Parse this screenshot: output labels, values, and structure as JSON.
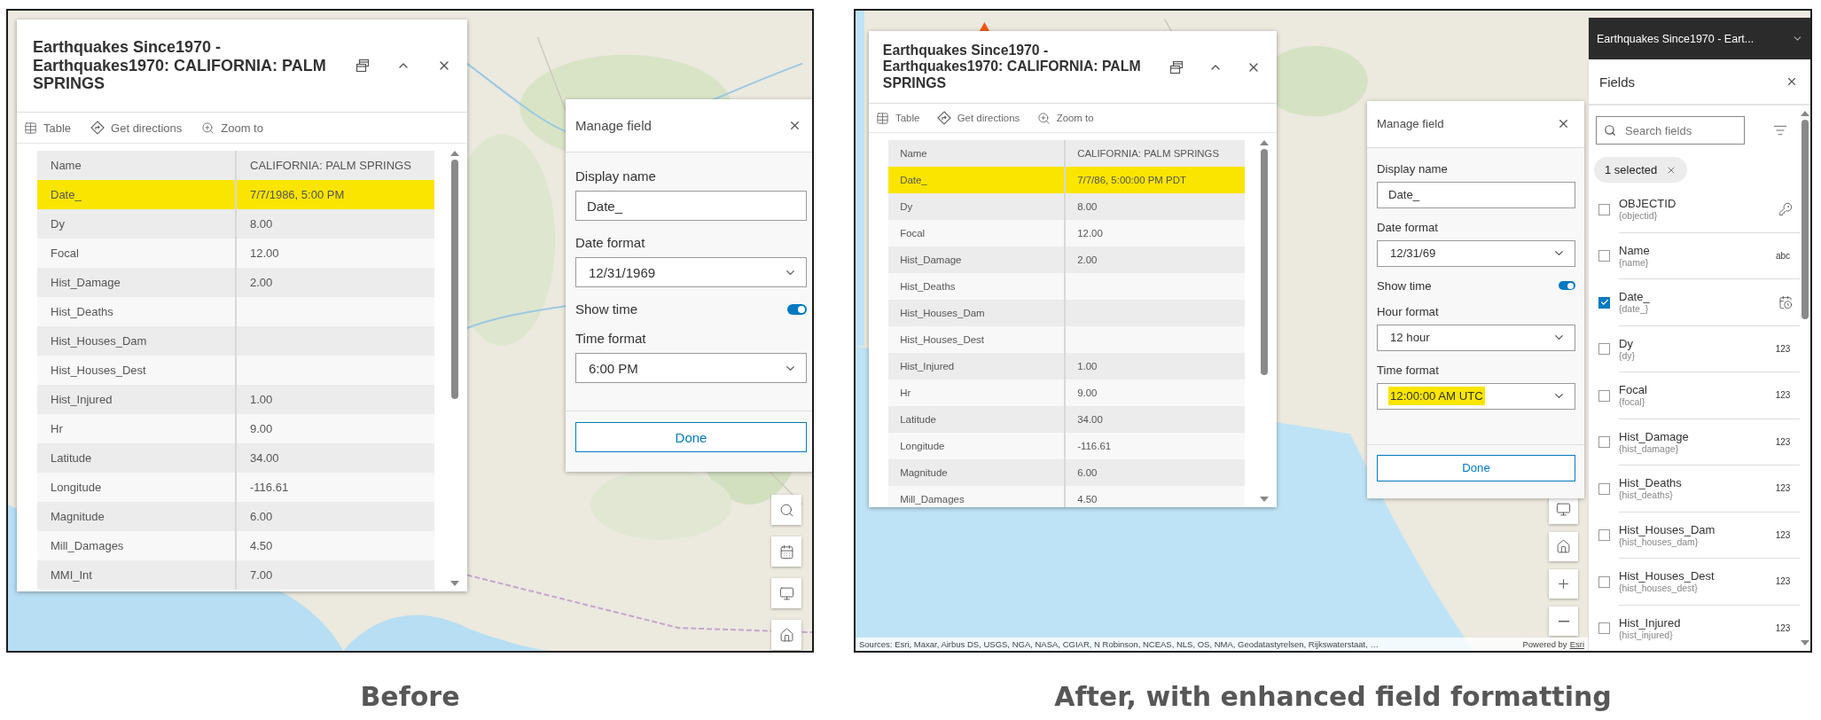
{
  "panels": [
    {
      "caption": "Before",
      "map": {
        "kind": "picture"
      },
      "popup": {
        "title": "Earthquakes Since1970 - Earthquakes1970: CALIFORNIA: PALM SPRINGS",
        "actions": [
          {
            "kind": "table",
            "label": "Table"
          },
          {
            "kind": "directions",
            "label": "Get directions"
          },
          {
            "kind": "zoom",
            "label": "Zoom to"
          }
        ],
        "rows": [
          {
            "name": "Name",
            "value": "CALIFORNIA: PALM SPRINGS",
            "highlighted": false
          },
          {
            "name": "Date_",
            "value": "7/7/1986, 5:00 PM",
            "highlighted": true
          },
          {
            "name": "Dy",
            "value": "8.00",
            "highlighted": false
          },
          {
            "name": "Focal",
            "value": "12.00",
            "highlighted": false
          },
          {
            "name": "Hist_Damage",
            "value": "2.00",
            "highlighted": false
          },
          {
            "name": "Hist_Deaths",
            "highlighted": false
          },
          {
            "name": "Hist_Houses_Dam",
            "highlighted": false
          },
          {
            "name": "Hist_Houses_Dest",
            "highlighted": false
          },
          {
            "name": "Hist_Injured",
            "value": "1.00",
            "highlighted": false
          },
          {
            "name": "Hr",
            "value": "9.00",
            "highlighted": false
          },
          {
            "name": "Latitude",
            "value": "34.00",
            "highlighted": false
          },
          {
            "name": "Longitude",
            "value": "-116.61",
            "highlighted": false
          },
          {
            "name": "Magnitude",
            "value": "6.00",
            "highlighted": false
          },
          {
            "name": "Mill_Damages",
            "value": "4.50",
            "highlighted": false
          },
          {
            "name": "MMI_Int",
            "value": "7.00",
            "highlighted": false
          }
        ]
      },
      "manage_field": {
        "title": "Manage field",
        "done": "Done",
        "settings": [
          {
            "kind": "text",
            "label": "Display name",
            "value": "Date_"
          },
          {
            "kind": "select",
            "label": "Date format",
            "value": "12/31/1969",
            "highlighted": false
          },
          {
            "kind": "toggle",
            "label": "Show time",
            "on": true
          },
          {
            "kind": "select",
            "label": "Time format",
            "value": "6:00 PM",
            "highlighted": false
          }
        ]
      },
      "map_controls": [
        {
          "kind": "search"
        },
        {
          "kind": "calendar"
        },
        {
          "kind": "screen"
        },
        {
          "kind": "home"
        }
      ]
    },
    {
      "caption": "After, with enhanced field formatting",
      "map": {
        "kind": "picture"
      },
      "popup": {
        "title": "Earthquakes Since1970 - Earthquakes1970: CALIFORNIA: PALM SPRINGS",
        "actions": [
          {
            "kind": "table",
            "label": "Table"
          },
          {
            "kind": "directions",
            "label": "Get directions"
          },
          {
            "kind": "zoom",
            "label": "Zoom to"
          }
        ],
        "rows": [
          {
            "name": "Name",
            "value": "CALIFORNIA: PALM SPRINGS",
            "highlighted": false
          },
          {
            "name": "Date_",
            "value": "7/7/86, 5:00:00 PM PDT",
            "highlighted": true
          },
          {
            "name": "Dy",
            "value": "8.00",
            "highlighted": false
          },
          {
            "name": "Focal",
            "value": "12.00",
            "highlighted": false
          },
          {
            "name": "Hist_Damage",
            "value": "2.00",
            "highlighted": false
          },
          {
            "name": "Hist_Deaths",
            "highlighted": false
          },
          {
            "name": "Hist_Houses_Dam",
            "highlighted": false
          },
          {
            "name": "Hist_Houses_Dest",
            "highlighted": false
          },
          {
            "name": "Hist_Injured",
            "value": "1.00",
            "highlighted": false
          },
          {
            "name": "Hr",
            "value": "9.00",
            "highlighted": false
          },
          {
            "name": "Latitude",
            "value": "34.00",
            "highlighted": false
          },
          {
            "name": "Longitude",
            "value": "-116.61",
            "highlighted": false
          },
          {
            "name": "Magnitude",
            "value": "6.00",
            "highlighted": false
          },
          {
            "name": "Mill_Damages",
            "value": "4.50",
            "highlighted": false
          }
        ]
      },
      "manage_field": {
        "title": "Manage field",
        "done": "Done",
        "settings": [
          {
            "kind": "text",
            "label": "Display name",
            "value": "Date_"
          },
          {
            "kind": "select",
            "label": "Date format",
            "value": "12/31/69",
            "highlighted": false
          },
          {
            "kind": "toggle",
            "label": "Show time",
            "on": true
          },
          {
            "kind": "select",
            "label": "Hour format",
            "value": "12 hour",
            "highlighted": false
          },
          {
            "kind": "select",
            "label": "Time format",
            "value": "12:00:00 AM UTC",
            "highlighted": true
          }
        ]
      },
      "map_controls": [
        {
          "kind": "screen"
        },
        {
          "kind": "home"
        },
        {
          "kind": "zoom-in"
        },
        {
          "kind": "zoom-out"
        }
      ],
      "attribution": {
        "sources": "Sources: Esri, Maxar, Airbus DS, USGS, NGA, NASA, CGIAR, N Robinson, NCEAS, NLS, OS, NMA, Geodatastyrelsen, Rijkswaterstaat, …",
        "powered_by": "Powered by",
        "link": "Esri"
      },
      "layer_panel": {
        "layer": "Earthquakes Since1970 - Eart...",
        "title": "Fields",
        "search": {
          "placeholder": "Search fields"
        },
        "chip": "1 selected",
        "fields": [
          {
            "name": "OBJECTID",
            "alias": "{objectid}",
            "kind": "key",
            "checked": false
          },
          {
            "name": "Name",
            "alias": "{name}",
            "kind": "text",
            "type_label": "abc",
            "checked": false
          },
          {
            "name": "Date_",
            "alias": "{date_}",
            "kind": "date",
            "checked": true
          },
          {
            "name": "Dy",
            "alias": "{dy}",
            "kind": "number",
            "type_label": "123",
            "checked": false
          },
          {
            "name": "Focal",
            "alias": "{focal}",
            "kind": "number",
            "type_label": "123",
            "checked": false
          },
          {
            "name": "Hist_Damage",
            "alias": "{hist_damage}",
            "kind": "number",
            "type_label": "123",
            "checked": false
          },
          {
            "name": "Hist_Deaths",
            "alias": "{hist_deaths}",
            "kind": "number",
            "type_label": "123",
            "checked": false
          },
          {
            "name": "Hist_Houses_Dam",
            "alias": "{hist_houses_dam}",
            "kind": "number",
            "type_label": "123",
            "checked": false
          },
          {
            "name": "Hist_Houses_Dest",
            "alias": "{hist_houses_dest}",
            "kind": "number",
            "type_label": "123",
            "checked": false
          },
          {
            "name": "Hist_Injured",
            "alias": "{hist_injured}",
            "kind": "number",
            "type_label": "123",
            "checked": false
          }
        ]
      }
    }
  ]
}
